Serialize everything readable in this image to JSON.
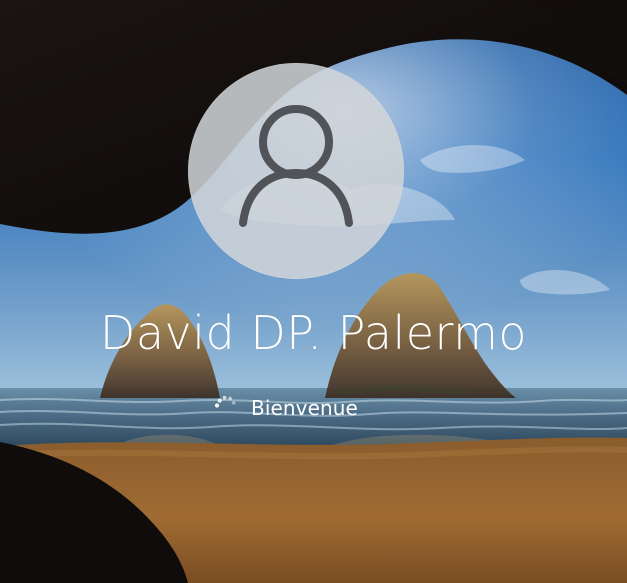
{
  "lock_screen": {
    "user": {
      "name": "David DP. Palermo",
      "avatar_icon": "user-icon"
    },
    "status": {
      "text": "Bienvenue",
      "spinner_icon": "loading-spinner-icon"
    },
    "colors": {
      "avatar_circle": "#d2d5d8",
      "avatar_glyph": "#505358",
      "text": "#ffffff"
    }
  }
}
